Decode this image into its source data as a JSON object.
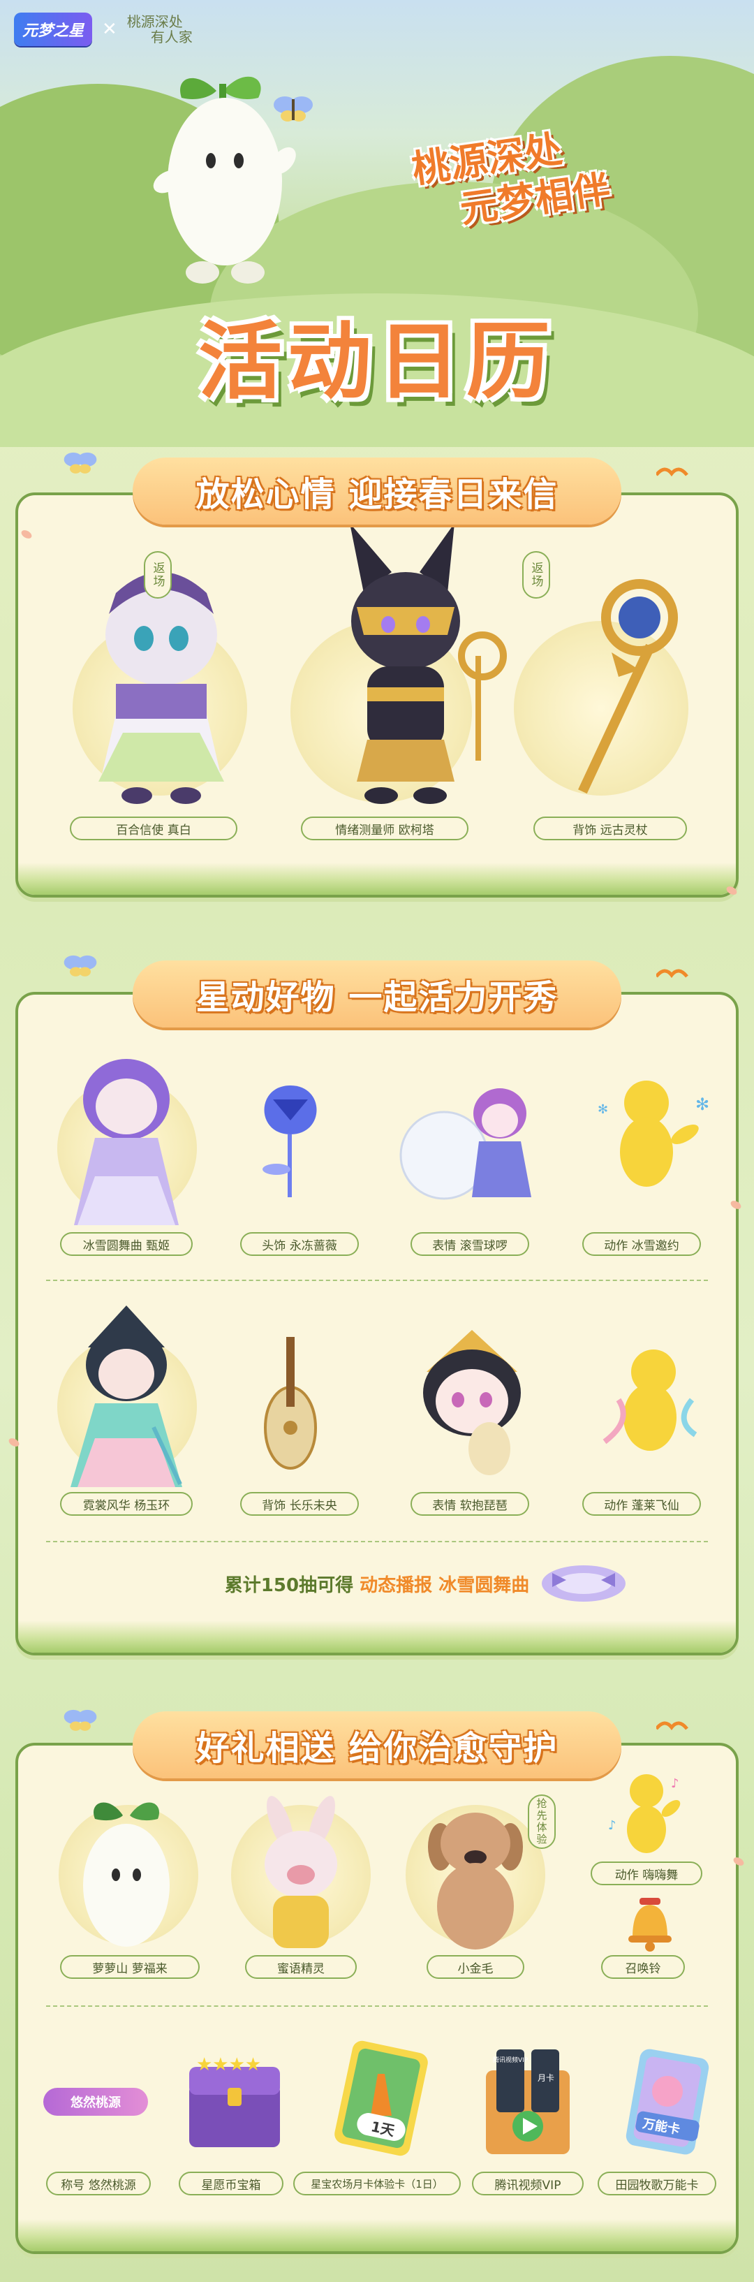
{
  "header": {
    "logo_text": "元梦之星",
    "cross": "✕",
    "sub_line1": "桃源深处",
    "sub_line2": "有人家"
  },
  "hero": {
    "slogan_line1": "桃源深处",
    "slogan_line2": "元梦相伴",
    "title": "活动日历"
  },
  "section1": {
    "title": "放松心情 迎接春日来信",
    "items": [
      {
        "label": "百合信使 真白",
        "tag": ""
      },
      {
        "label": "情绪测量师 欧柯塔",
        "tag": "返场"
      },
      {
        "label": "背饰 远古灵杖",
        "tag": "返场"
      }
    ]
  },
  "section2": {
    "title": "星动好物 一起活力开秀",
    "row1": [
      {
        "label": "冰雪圆舞曲 甄姬"
      },
      {
        "label": "头饰 永冻蔷薇"
      },
      {
        "label": "表情 滚雪球啰"
      },
      {
        "label": "动作 冰雪邀约"
      }
    ],
    "row2": [
      {
        "label": "霓裳风华 杨玉环"
      },
      {
        "label": "背饰 长乐未央"
      },
      {
        "label": "表情 软抱琵琶"
      },
      {
        "label": "动作 蓬莱飞仙"
      }
    ],
    "bonus_prefix": "累计150抽可得",
    "bonus_highlight": "动态播报 冰雪圆舞曲"
  },
  "section3": {
    "title": "好礼相送 给你治愈守护",
    "row1": [
      {
        "label": "萝萝山 萝福来",
        "tag": ""
      },
      {
        "label": "蜜语精灵",
        "tag": ""
      },
      {
        "label": "小金毛",
        "tag": "抢先体验"
      },
      {
        "label": "动作 嗨嗨舞",
        "tag": ""
      },
      {
        "label": "召唤铃",
        "tag": ""
      }
    ],
    "row2": [
      {
        "label": "称号 悠然桃源",
        "badge": "悠然桃源"
      },
      {
        "label": "星愿币宝箱"
      },
      {
        "label": "星宝农场月卡体验卡（1日）",
        "card": "1天"
      },
      {
        "label": "腾讯视频VIP",
        "card_top": "腾讯视频VIP",
        "card_mid": "月卡"
      },
      {
        "label": "田园牧歌万能卡",
        "card": "万能卡"
      }
    ]
  },
  "colors": {
    "accent_orange": "#f3833b",
    "border_green": "#79a24a",
    "panel_cream": "#fbf6dd"
  }
}
